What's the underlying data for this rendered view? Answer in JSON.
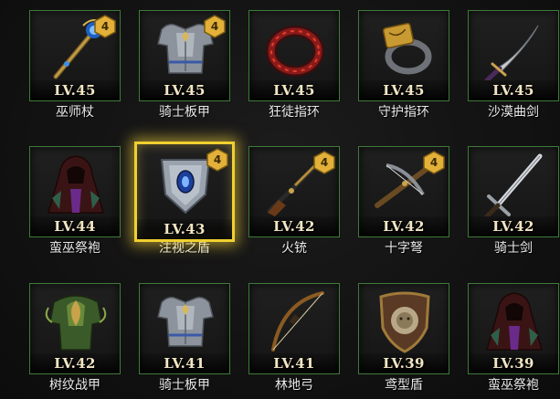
{
  "items": [
    {
      "level": "LV.45",
      "name": "巫师杖",
      "badge": "4",
      "icon": "wizard-staff-icon"
    },
    {
      "level": "LV.45",
      "name": "骑士板甲",
      "badge": "4",
      "icon": "plate-armor-icon"
    },
    {
      "level": "LV.45",
      "name": "狂徒指环",
      "badge": "",
      "icon": "red-ring-icon"
    },
    {
      "level": "LV.45",
      "name": "守护指环",
      "badge": "",
      "icon": "gold-ring-icon"
    },
    {
      "level": "LV.45",
      "name": "沙漠曲剑",
      "badge": "",
      "icon": "scimitar-icon"
    },
    {
      "level": "LV.44",
      "name": "蛮巫祭袍",
      "badge": "",
      "icon": "hooded-robe-icon"
    },
    {
      "level": "LV.43",
      "name": "注视之盾",
      "badge": "4",
      "icon": "eye-shield-icon"
    },
    {
      "level": "LV.42",
      "name": "火铳",
      "badge": "4",
      "icon": "musket-icon"
    },
    {
      "level": "LV.42",
      "name": "十字弩",
      "badge": "4",
      "icon": "crossbow-icon"
    },
    {
      "level": "LV.42",
      "name": "骑士剑",
      "badge": "",
      "icon": "longsword-icon"
    },
    {
      "level": "LV.42",
      "name": "树纹战甲",
      "badge": "",
      "icon": "leaf-armor-icon"
    },
    {
      "level": "LV.41",
      "name": "骑士板甲",
      "badge": "",
      "icon": "plate-armor-icon"
    },
    {
      "level": "LV.41",
      "name": "林地弓",
      "badge": "",
      "icon": "longbow-icon"
    },
    {
      "level": "LV.39",
      "name": "鸢型盾",
      "badge": "",
      "icon": "lion-shield-icon"
    },
    {
      "level": "LV.39",
      "name": "蛮巫祭袍",
      "badge": "",
      "icon": "hooded-robe-icon"
    }
  ],
  "selected_index": 6,
  "colors": {
    "slot_border": "#3f7a3a",
    "selected_border": "#f0d030",
    "badge_fill": "#e3b13a",
    "level_text": "#f2e6c4",
    "name_text": "#e8e8e8"
  }
}
